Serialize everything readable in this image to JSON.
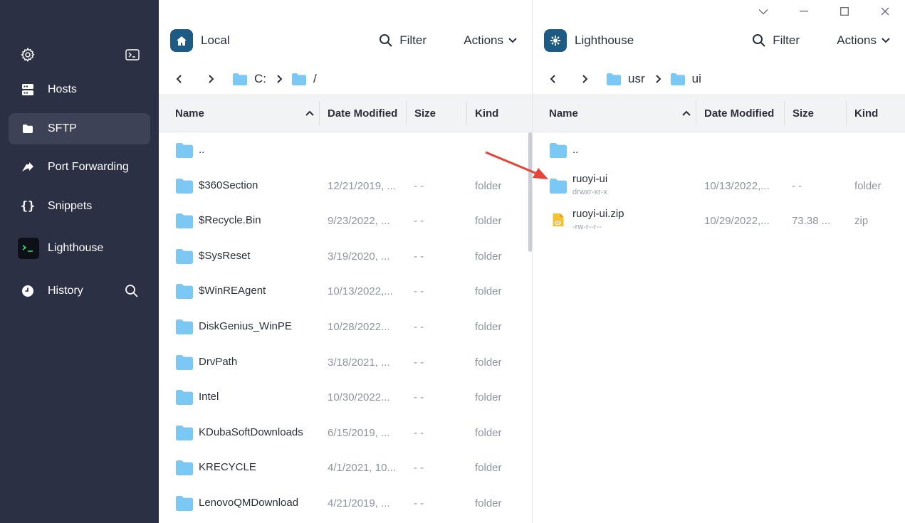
{
  "sidebar": {
    "items": [
      {
        "label": "Hosts",
        "icon": "server-icon"
      },
      {
        "label": "SFTP",
        "icon": "folder-icon",
        "active": true
      },
      {
        "label": "Port Forwarding",
        "icon": "forward-icon"
      },
      {
        "label": "Snippets",
        "icon": "braces-icon"
      },
      {
        "label": "Lighthouse",
        "icon": "terminal-prompt-icon"
      },
      {
        "label": "History",
        "icon": "clock-icon"
      }
    ]
  },
  "colors": {
    "sidebar_bg": "#2b3045",
    "sidebar_active": "#3d4256",
    "host_badge": "#1d5b85",
    "folder": "#7cc8f4",
    "annotation_arrow": "#e84339"
  },
  "left_panel": {
    "host": "Local",
    "filter_label": "Filter",
    "actions_label": "Actions",
    "path": [
      "C:",
      "/"
    ],
    "columns": {
      "name": "Name",
      "date": "Date Modified",
      "size": "Size",
      "kind": "Kind"
    },
    "rows": [
      {
        "name": "..",
        "date": "",
        "size": "",
        "kind": ""
      },
      {
        "name": "$360Section",
        "date": "12/21/2019, ...",
        "size": "- -",
        "kind": "folder"
      },
      {
        "name": "$Recycle.Bin",
        "date": "9/23/2022, ...",
        "size": "- -",
        "kind": "folder"
      },
      {
        "name": "$SysReset",
        "date": "3/19/2020, ...",
        "size": "- -",
        "kind": "folder"
      },
      {
        "name": "$WinREAgent",
        "date": "10/13/2022,...",
        "size": "- -",
        "kind": "folder"
      },
      {
        "name": "DiskGenius_WinPE",
        "date": "10/28/2022...",
        "size": "- -",
        "kind": "folder"
      },
      {
        "name": "DrvPath",
        "date": "3/18/2021, ...",
        "size": "- -",
        "kind": "folder"
      },
      {
        "name": "Intel",
        "date": "10/30/2022...",
        "size": "- -",
        "kind": "folder"
      },
      {
        "name": "KDubaSoftDownloads",
        "date": "6/15/2019, ...",
        "size": "- -",
        "kind": "folder"
      },
      {
        "name": "KRECYCLE",
        "date": "4/1/2021, 10...",
        "size": "- -",
        "kind": "folder"
      },
      {
        "name": "LenovoQMDownload",
        "date": "4/21/2019, ...",
        "size": "- -",
        "kind": "folder"
      }
    ]
  },
  "right_panel": {
    "host": "Lighthouse",
    "filter_label": "Filter",
    "actions_label": "Actions",
    "path": [
      "usr",
      "ui"
    ],
    "columns": {
      "name": "Name",
      "date": "Date Modified",
      "size": "Size",
      "kind": "Kind"
    },
    "rows": [
      {
        "name": "..",
        "perm": "",
        "date": "",
        "size": "",
        "kind": "",
        "type": "folder"
      },
      {
        "name": "ruoyi-ui",
        "perm": "drwxr-xr-x",
        "date": "10/13/2022,...",
        "size": "- -",
        "kind": "folder",
        "type": "folder"
      },
      {
        "name": "ruoyi-ui.zip",
        "perm": "-rw-r--r--",
        "date": "10/29/2022,...",
        "size": "73.38 ...",
        "kind": "zip",
        "type": "zip"
      }
    ]
  }
}
